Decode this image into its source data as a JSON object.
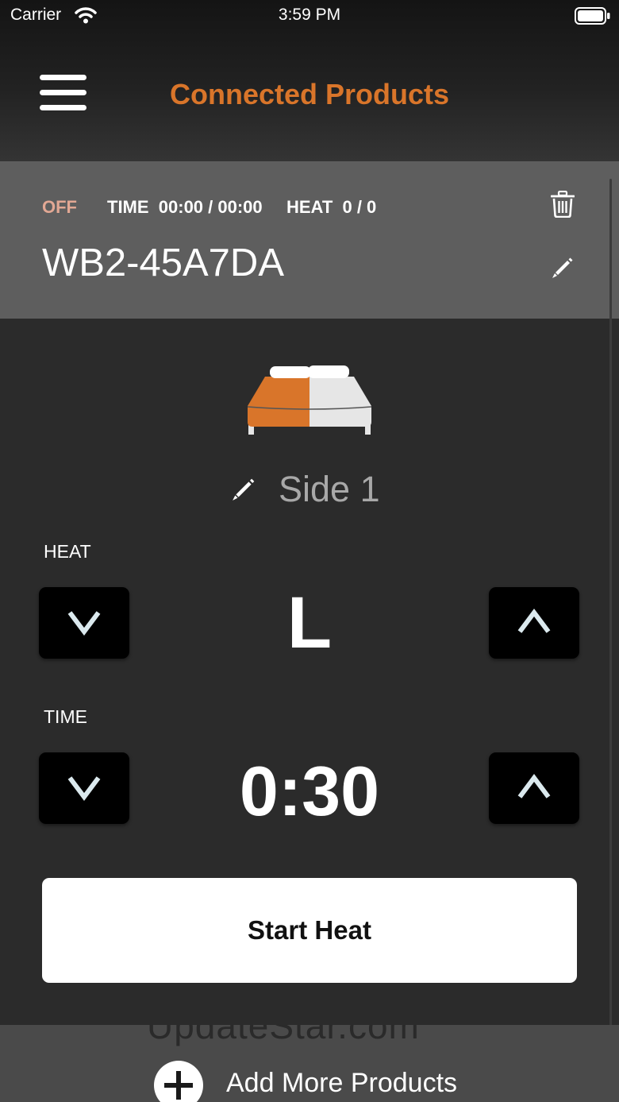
{
  "status_bar": {
    "carrier": "Carrier",
    "time": "3:59 PM"
  },
  "header": {
    "title": "Connected Products",
    "menu_icon": "hamburger-menu-icon"
  },
  "device": {
    "power_status": "OFF",
    "time_status": "TIME  00:00 / 00:00",
    "heat_status": "HEAT  0 / 0",
    "name": "WB2-45A7DA",
    "delete_icon": "trash-icon",
    "edit_icon": "pencil-icon"
  },
  "zone": {
    "side_name": "Side 1",
    "bed_icon": "bed-icon",
    "bed_colors": {
      "selected": "#d9752a",
      "other": "#e6e6e6"
    },
    "heat_label": "HEAT",
    "heat_value": "L",
    "time_label": "TIME",
    "time_value": "0:30"
  },
  "actions": {
    "start_label": "Start Heat"
  },
  "footer": {
    "watermark": "UpdateStar.com",
    "add_label": "Add More Products",
    "add_icon": "plus-circle-icon"
  },
  "colors": {
    "accent": "#d9752a",
    "background": "#2b2b2b",
    "card": "#5e5e5e",
    "off_status": "#e2a894"
  }
}
